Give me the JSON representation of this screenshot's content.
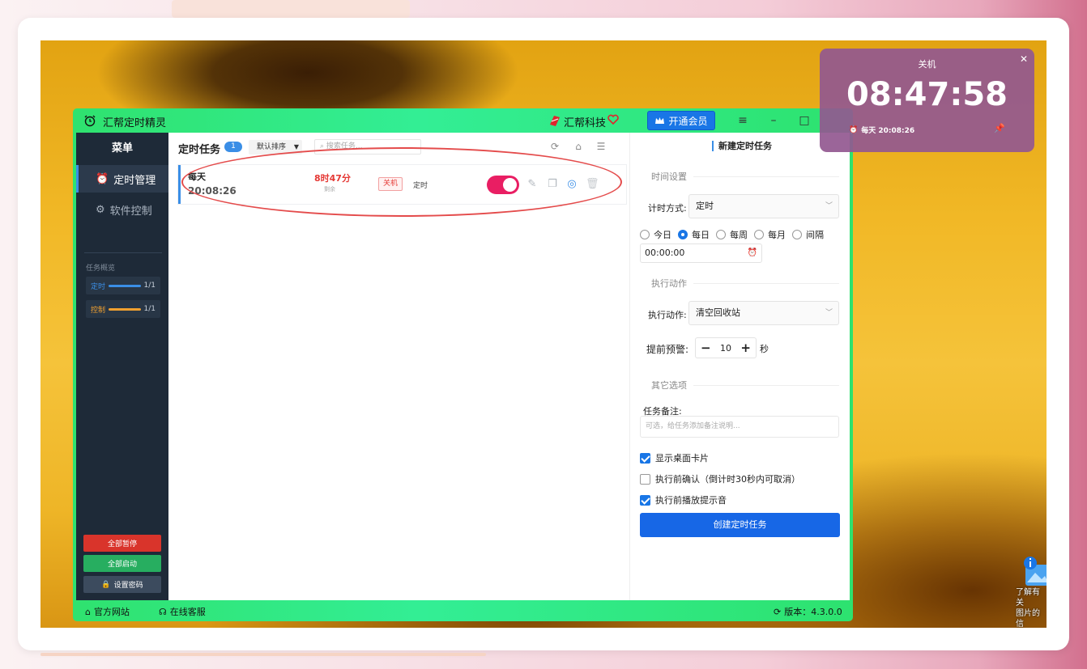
{
  "app": {
    "title": "汇帮定时精灵",
    "brand": "汇帮科技",
    "vip_label": "开通会员"
  },
  "sidebar": {
    "header": "菜单",
    "items": [
      {
        "label": "定时管理",
        "icon": "alarm-clock-icon",
        "active": true
      },
      {
        "label": "软件控制",
        "icon": "gear-icon",
        "active": false
      }
    ],
    "overview_title": "任务概览",
    "stats": [
      {
        "label": "定时",
        "count": "1/1",
        "color": "#3a8ee6",
        "progress": 1.0
      },
      {
        "label": "控制",
        "count": "1/1",
        "color": "#f0a030",
        "progress": 1.0
      }
    ],
    "buttons": [
      {
        "label": "全部暂停",
        "color": "#d9342b"
      },
      {
        "label": "全部启动",
        "color": "#27ae60"
      },
      {
        "label": "设置密码",
        "color": "#3c4b5e"
      }
    ]
  },
  "main": {
    "title": "定时任务",
    "count_badge": "1",
    "sort_label": "默认排序",
    "search_placeholder": "搜索任务...",
    "tasks": [
      {
        "name": "每天",
        "time": "20:08:26",
        "remaining": "8时47分",
        "remaining_label": "剩余",
        "action_tag": "关机",
        "type": "定时",
        "enabled": true
      }
    ]
  },
  "panel": {
    "title": "新建定时任务",
    "section_time": "时间设置",
    "mode_label": "计时方式:",
    "mode_value": "定时",
    "repeat_options": [
      {
        "label": "今日",
        "selected": false
      },
      {
        "label": "每日",
        "selected": true
      },
      {
        "label": "每周",
        "selected": false
      },
      {
        "label": "每月",
        "selected": false
      },
      {
        "label": "间隔",
        "selected": false
      }
    ],
    "time_value": "00:00:00",
    "section_action": "执行动作",
    "action_label": "执行动作:",
    "action_value": "清空回收站",
    "warn_label": "提前预警:",
    "warn_value": "10",
    "warn_unit": "秒",
    "section_other": "其它选项",
    "note_label": "任务备注:",
    "note_placeholder": "可选，给任务添加备注说明...",
    "checks": [
      {
        "label": "显示桌面卡片",
        "checked": true
      },
      {
        "label": "执行前确认（倒计时30秒内可取消）",
        "checked": false
      },
      {
        "label": "执行前播放提示音",
        "checked": true
      }
    ],
    "create_label": "创建定时任务"
  },
  "status": {
    "website": "官方网站",
    "support": "在线客服",
    "version": "版本：4.3.0.0"
  },
  "widget": {
    "title": "关机",
    "clock": "08:47:58",
    "subtitle": "每天 20:08:26"
  },
  "desktop": {
    "icon_text_1": "了解有关",
    "icon_text_2": "图片的信"
  }
}
